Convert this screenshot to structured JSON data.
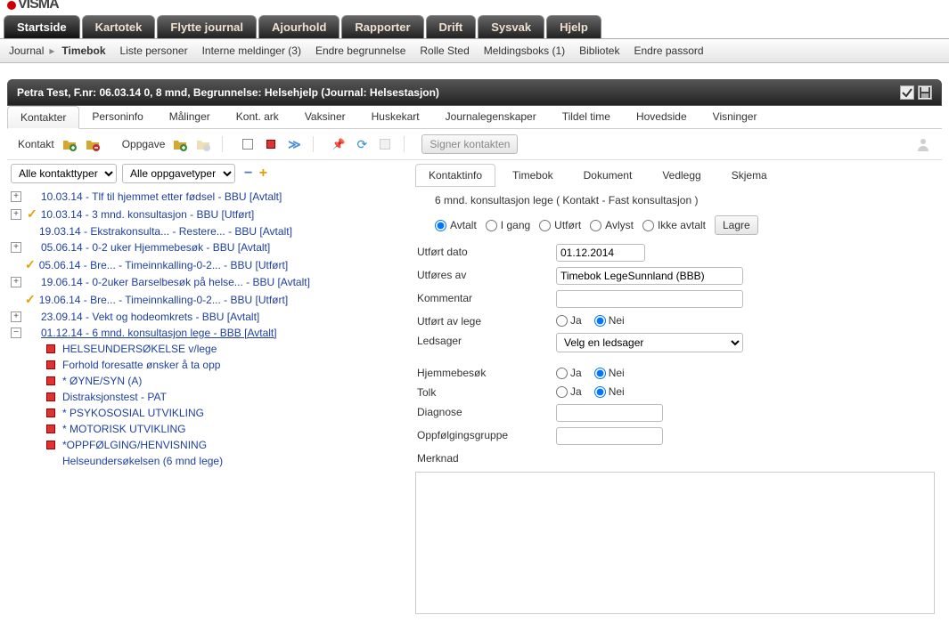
{
  "app": {
    "logo": "VISMA"
  },
  "main_tabs": [
    "Startside",
    "Kartotek",
    "Flytte journal",
    "Ajourhold",
    "Rapporter",
    "Drift",
    "Sysvak",
    "Hjelp"
  ],
  "sub_nav": {
    "journal": "Journal",
    "timebok": "Timebok",
    "items": [
      "Liste personer",
      "Interne meldinger (3)",
      "Endre begrunnelse",
      "Rolle Sted",
      "Meldingsboks (1)",
      "Bibliotek",
      "Endre passord"
    ]
  },
  "patient_header": "Petra Test, F.nr: 06.03.14 0, 8 mnd, Begrunnelse: Helsehjelp (Journal: Helsestasjon)",
  "inner_tabs": [
    "Kontakter",
    "Personinfo",
    "Målinger",
    "Kont. ark",
    "Vaksiner",
    "Huskekart",
    "Journalegenskaper",
    "Tildel time",
    "Hovedside",
    "Visninger"
  ],
  "toolbar": {
    "kontakt_label": "Kontakt",
    "oppgave_label": "Oppgave",
    "signer_btn": "Signer kontakten"
  },
  "filters": {
    "contact_types": {
      "selected": "Alle kontakttyper"
    },
    "task_types": {
      "selected": "Alle oppgavetyper"
    }
  },
  "tree": [
    {
      "exp": "+",
      "check": false,
      "text": "10.03.14 - Tlf til hjemmet etter fødsel - BBU [Avtalt]"
    },
    {
      "exp": "+",
      "check": true,
      "text": "10.03.14 - 3 mnd. konsultasjon - BBU [Utført]"
    },
    {
      "exp": "",
      "check": false,
      "text": "19.03.14 - Ekstrakonsulta... - Restere... - BBU [Avtalt]"
    },
    {
      "exp": "+",
      "check": false,
      "text": "05.06.14 - 0-2 uker Hjemmebesøk - BBU [Avtalt]"
    },
    {
      "exp": "",
      "check": true,
      "text": "05.06.14 - Bre... - Timeinnkalling-0-2... - BBU [Utført]"
    },
    {
      "exp": "+",
      "check": false,
      "text": "19.06.14 - 0-2uker Barselbesøk på helse... - BBU [Avtalt]"
    },
    {
      "exp": "",
      "check": true,
      "text": "19.06.14 - Bre... - Timeinnkalling-0-2... - BBU [Utført]"
    },
    {
      "exp": "+",
      "check": false,
      "text": "23.09.14 - Vekt og hodeomkrets - BBU [Avtalt]"
    },
    {
      "exp": "-",
      "check": false,
      "text": "01.12.14 - 6 mnd. konsultasjon lege - BBB [Avtalt]",
      "selected": true
    }
  ],
  "children": [
    {
      "sq": true,
      "text": "HELSEUNDERSØKELSE v/lege"
    },
    {
      "sq": true,
      "text": "Forhold foresatte ønsker å ta opp"
    },
    {
      "sq": true,
      "text": "* ØYNE/SYN (A)"
    },
    {
      "sq": true,
      "text": "Distraksjonstest - PAT"
    },
    {
      "sq": true,
      "text": "* PSYKOSOSIAL UTVIKLING"
    },
    {
      "sq": true,
      "text": "* MOTORISK UTVIKLING"
    },
    {
      "sq": true,
      "text": "*OPPFØLGING/HENVISNING"
    },
    {
      "sq": false,
      "text": "Helseundersøkelsen (6 mnd lege)"
    }
  ],
  "right": {
    "tabs": [
      "Kontaktinfo",
      "Timebok",
      "Dokument",
      "Vedlegg",
      "Skjema"
    ],
    "title": "6 mnd. konsultasjon lege ( Kontakt - Fast konsultasjon )",
    "statuses": [
      "Avtalt",
      "I gang",
      "Utført",
      "Avlyst",
      "Ikke avtalt"
    ],
    "status_selected": "Avtalt",
    "save_btn": "Lagre",
    "fields": {
      "utfort_dato_label": "Utført dato",
      "utfort_dato_value": "01.12.2014",
      "utfores_av_label": "Utføres av",
      "utfores_av_value": "Timebok LegeSunnland (BBB)",
      "kommentar_label": "Kommentar",
      "kommentar_value": "",
      "utfort_av_lege_label": "Utført av lege",
      "utfort_av_lege_value": "Nei",
      "ja": "Ja",
      "nei": "Nei",
      "ledsager_label": "Ledsager",
      "ledsager_value": "Velg en ledsager",
      "hjemmebesok_label": "Hjemmebesøk",
      "hjemmebesok_value": "Nei",
      "tolk_label": "Tolk",
      "tolk_value": "Nei",
      "diagnose_label": "Diagnose",
      "diagnose_value": "",
      "oppfolging_label": "Oppfølgingsgruppe",
      "oppfolging_value": "",
      "merknad_label": "Merknad"
    }
  }
}
